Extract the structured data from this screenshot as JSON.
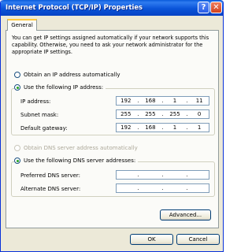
{
  "window": {
    "title": "Internet Protocol (TCP/IP) Properties",
    "help_glyph": "?",
    "close_glyph": "✕"
  },
  "tabs": [
    {
      "label": "General"
    }
  ],
  "intro_text": "You can get IP settings assigned automatically if your network supports this capability. Otherwise, you need to ask your network administrator for the appropriate IP settings.",
  "ip_mode": {
    "auto_label": "Obtain an IP address automatically",
    "manual_label": "Use the following IP address:"
  },
  "ip_fields": [
    {
      "label": "IP address:",
      "octets": [
        "192",
        "168",
        "1",
        "11"
      ]
    },
    {
      "label": "Subnet mask:",
      "octets": [
        "255",
        "255",
        "255",
        "0"
      ]
    },
    {
      "label": "Default gateway:",
      "octets": [
        "192",
        "168",
        "1",
        "1"
      ]
    }
  ],
  "dns_mode": {
    "auto_label": "Obtain DNS server address automatically",
    "manual_label": "Use the following DNS server addresses:"
  },
  "dns_fields": [
    {
      "label": "Preferred DNS server:",
      "octets": [
        "",
        "",
        "",
        ""
      ]
    },
    {
      "label": "Alternate DNS server:",
      "octets": [
        "",
        "",
        "",
        ""
      ]
    }
  ],
  "buttons": {
    "advanced": "Advanced...",
    "ok": "OK",
    "cancel": "Cancel"
  },
  "separator": "."
}
